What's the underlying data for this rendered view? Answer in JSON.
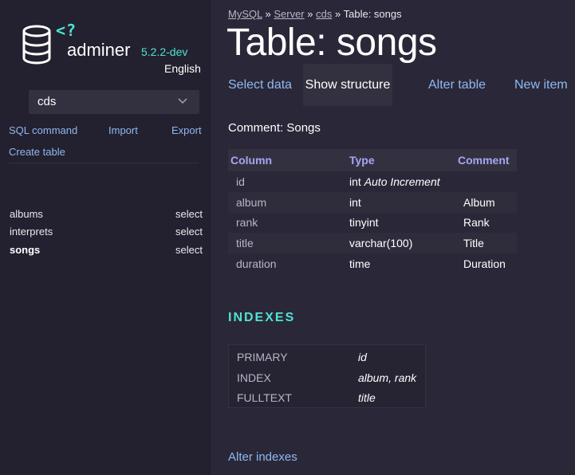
{
  "app": {
    "logo_code": "<?",
    "name": "adminer",
    "version": "5.2.2-dev",
    "language": "English"
  },
  "sidebar": {
    "db_select_value": "cds",
    "links": {
      "sql": "SQL command",
      "import": "Import",
      "export": "Export",
      "create": "Create table"
    },
    "tables": [
      {
        "name": "albums",
        "action": "select",
        "active": false
      },
      {
        "name": "interprets",
        "action": "select",
        "active": false
      },
      {
        "name": "songs",
        "action": "select",
        "active": true
      }
    ]
  },
  "breadcrumb": {
    "items": [
      "MySQL",
      "Server",
      "cds"
    ],
    "separator": "»",
    "current": "Table: songs"
  },
  "page_title": "Table: songs",
  "tabs": [
    {
      "label": "Select data",
      "active": false
    },
    {
      "label": "Show structure",
      "active": true
    },
    {
      "label": "Alter table",
      "active": false
    },
    {
      "label": "New item",
      "active": false
    }
  ],
  "comment": "Comment: Songs",
  "structure": {
    "headers": [
      "Column",
      "Type",
      "Comment"
    ],
    "rows": [
      {
        "column": "id",
        "type": "int",
        "type_extra": "Auto Increment",
        "comment": ""
      },
      {
        "column": "album",
        "type": "int",
        "type_extra": "",
        "comment": "Album"
      },
      {
        "column": "rank",
        "type": "tinyint",
        "type_extra": "",
        "comment": "Rank"
      },
      {
        "column": "title",
        "type": "varchar(100)",
        "type_extra": "",
        "comment": "Title"
      },
      {
        "column": "duration",
        "type": "time",
        "type_extra": "",
        "comment": "Duration"
      }
    ]
  },
  "indexes": {
    "title": "INDEXES",
    "rows": [
      {
        "type": "PRIMARY",
        "columns": "id"
      },
      {
        "type": "INDEX",
        "columns": "album, rank"
      },
      {
        "type": "FULLTEXT",
        "columns": "title"
      }
    ],
    "alter_link": "Alter indexes"
  },
  "colors": {
    "accent": "#4fe3d3",
    "link": "#8fb8f2",
    "header_text": "#a6a6f6",
    "background": "#2a2838",
    "sidebar": "#23212f"
  }
}
